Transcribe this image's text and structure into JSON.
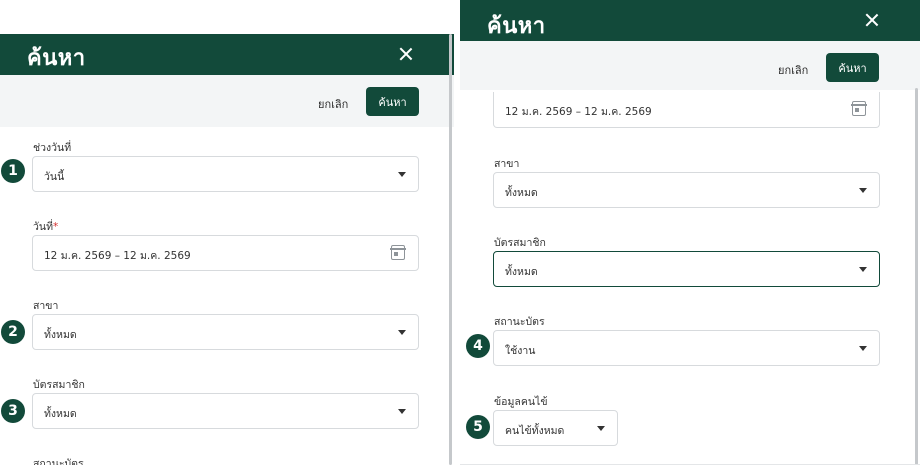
{
  "dialog": {
    "title": "ค้นหา",
    "cancel_label": "ยกเลิก",
    "search_label": "ค้นหา"
  },
  "fields": {
    "date_range": {
      "label": "ช่วงวันที่",
      "value": "วันนี้"
    },
    "date": {
      "label": "วันที่",
      "required_mark": "*",
      "value": "12 ม.ค. 2569 – 12 ม.ค. 2569"
    },
    "branch": {
      "label": "สาขา",
      "value": "ทั้งหมด"
    },
    "member_card": {
      "label": "บัตรสมาชิก",
      "value": "ทั้งหมด"
    },
    "card_status": {
      "label": "สถานะบัตร",
      "value": "ใช้งาน"
    },
    "patient_info": {
      "label": "ข้อมูลคนไข้",
      "value": "คนไข้ทั้งหมด"
    }
  },
  "markers": [
    "1",
    "2",
    "3",
    "4",
    "5"
  ],
  "colors": {
    "header": "#124a3a",
    "action_bar": "#f3f5f6",
    "marker": "#124a3a",
    "required": "#d32f2f"
  },
  "icons": {
    "close": "close-icon",
    "calendar": "calendar-icon",
    "dropdown": "chevron-down-icon"
  }
}
